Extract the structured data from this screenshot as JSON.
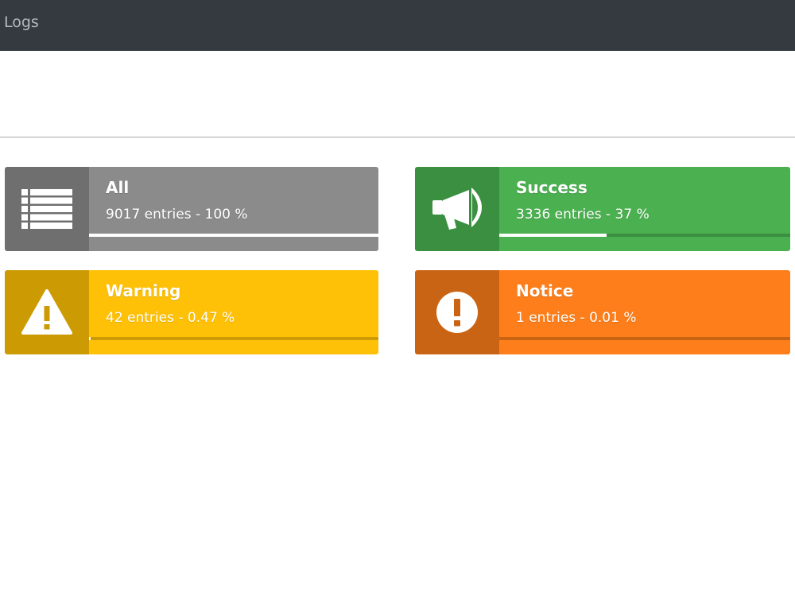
{
  "header": {
    "title": "Logs"
  },
  "colors": {
    "all_icon_bg": "#6f6f6f",
    "all_bg": "#8b8b8b",
    "all_track": "#6f6f6f",
    "success_icon_bg": "#3b8f40",
    "success_bg": "#4bb050",
    "success_track": "#3b8f40",
    "warning_icon_bg": "#cc9b04",
    "warning_bg": "#fec107",
    "warning_track": "#cc9b04",
    "notice_icon_bg": "#c96414",
    "notice_bg": "#fd7e1a",
    "notice_track": "#c96414",
    "progress_fill": "#ffffff"
  },
  "stats": [
    {
      "id": "all",
      "label": "All",
      "count_text": "9017 entries - 100 %",
      "percent": 100,
      "icon": "list-icon"
    },
    {
      "id": "success",
      "label": "Success",
      "count_text": "3336 entries - 37 %",
      "percent": 37,
      "icon": "megaphone-icon"
    },
    {
      "id": "warning",
      "label": "Warning",
      "count_text": "42 entries - 0.47 %",
      "percent": 0.47,
      "icon": "warning-icon"
    },
    {
      "id": "notice",
      "label": "Notice",
      "count_text": "1 entries - 0.01 %",
      "percent": 0.01,
      "icon": "exclamation-circle-icon"
    }
  ]
}
